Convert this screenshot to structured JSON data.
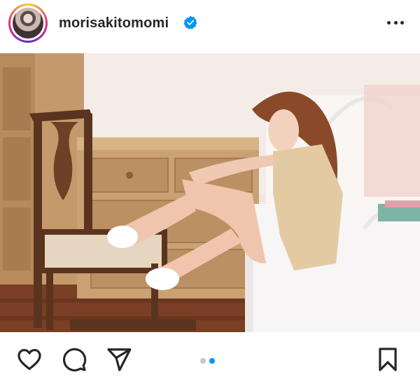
{
  "post": {
    "username": "morisakitomomi",
    "verified": true,
    "accent_color": "#0095f6"
  },
  "carousel": {
    "total": 2,
    "current": 2
  },
  "icons": {
    "verified": "verified-badge-icon",
    "more": "more-options-icon",
    "like": "heart-icon",
    "comment": "comment-icon",
    "share": "send-icon",
    "save": "bookmark-icon"
  }
}
